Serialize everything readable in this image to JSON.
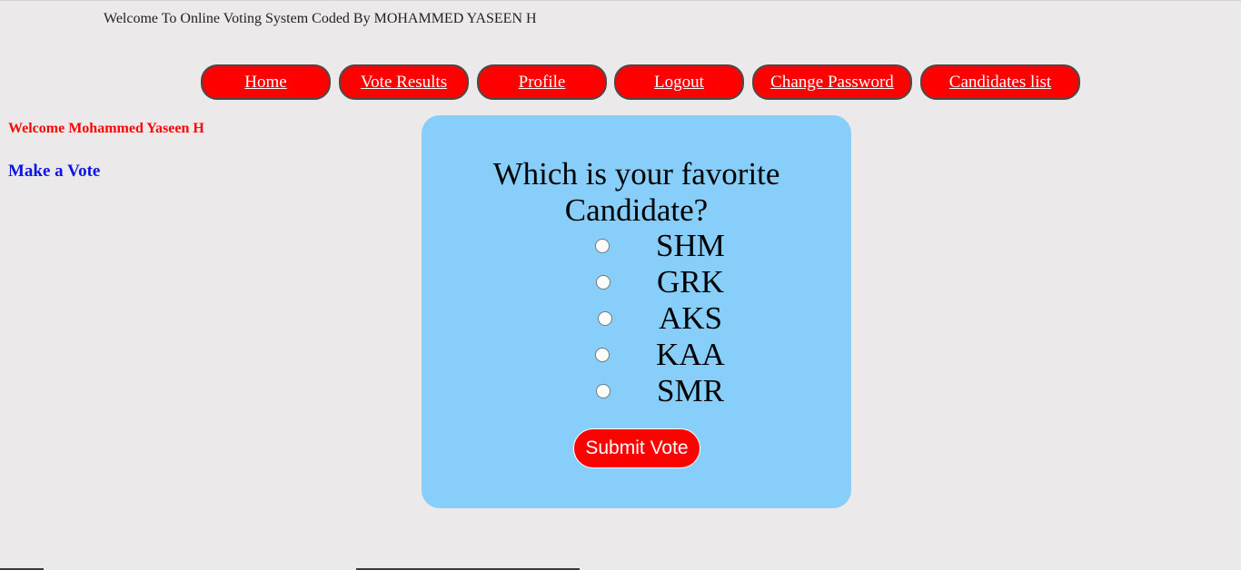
{
  "banner": {
    "text": "Welcome To Online Voting System Coded By MOHAMMED YASEEN H"
  },
  "nav": {
    "items": [
      {
        "label": "Home"
      },
      {
        "label": "Vote Results"
      },
      {
        "label": "Profile"
      },
      {
        "label": "Logout"
      },
      {
        "label": "Change Password"
      },
      {
        "label": "Candidates list"
      }
    ]
  },
  "sidebar": {
    "welcome": "Welcome Mohammed Yaseen H",
    "make_vote": "Make a Vote"
  },
  "poll": {
    "question_line1": "Which is your favorite",
    "question_line2": "Candidate?",
    "options": [
      {
        "label": "SHM",
        "selected": false
      },
      {
        "label": "GRK",
        "selected": false
      },
      {
        "label": "AKS",
        "selected": false
      },
      {
        "label": "KAA",
        "selected": false
      },
      {
        "label": "SMR",
        "selected": false
      }
    ],
    "submit_label": "Submit Vote"
  },
  "colors": {
    "page_background": "#ebe9e9",
    "nav_button": "#ff0000",
    "panel_background": "#87cefa",
    "welcome_text": "#ff0000",
    "make_vote_link": "#0a14e6"
  }
}
